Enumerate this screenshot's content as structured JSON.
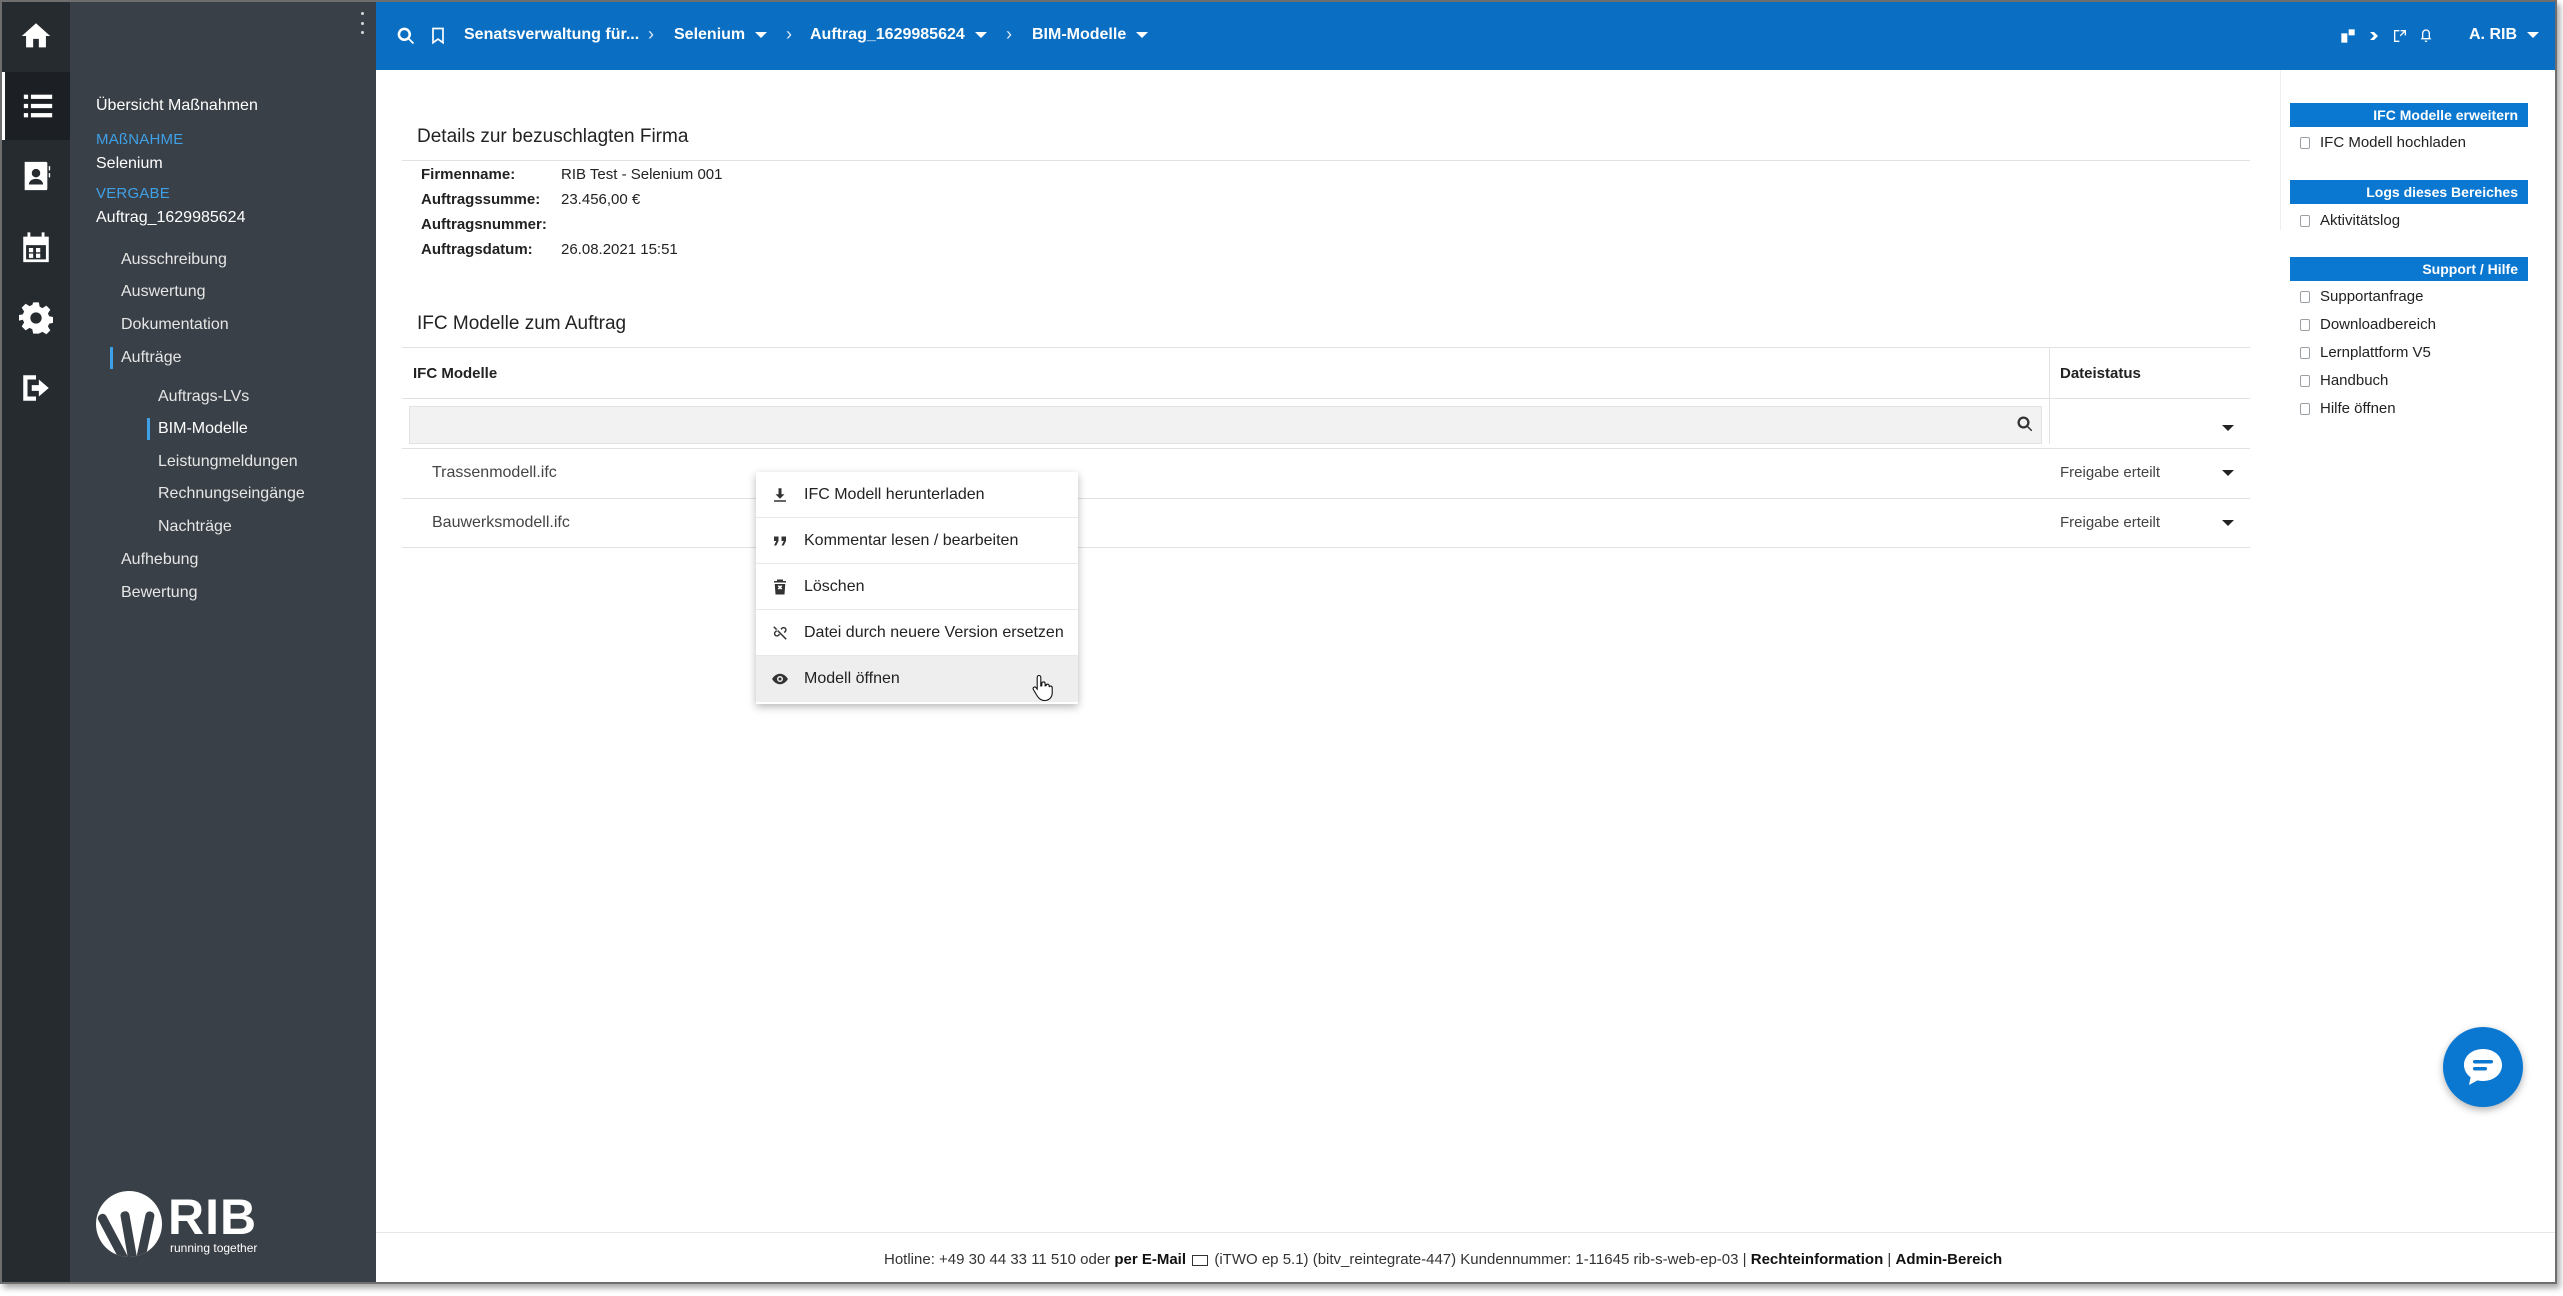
{
  "topbar": {
    "crumbs": [
      "Senatsverwaltung für...",
      "Selenium",
      "Auftrag_1629985624",
      "BIM-Modelle"
    ],
    "user": "A. RIB"
  },
  "sidebar": {
    "overview": "Übersicht Maßnahmen",
    "massnahme_caption": "MAßNAHME",
    "massnahme_value": "Selenium",
    "vergabe_caption": "VERGABE",
    "vergabe_value": "Auftrag_1629985624",
    "nav": [
      "Ausschreibung",
      "Auswertung",
      "Dokumentation",
      "Aufträge"
    ],
    "subnav": [
      "Auftrags-LVs",
      "BIM-Modelle",
      "Leistungmeldungen",
      "Rechnungseingänge",
      "Nachträge"
    ],
    "nav_bottom": [
      "Aufhebung",
      "Bewertung"
    ],
    "logo_word": "RIB",
    "logo_tagline": "running together"
  },
  "details": {
    "heading": "Details zur bezuschlagten Firma",
    "fields": [
      {
        "label": "Firmenname:",
        "value": "RIB Test - Selenium 001"
      },
      {
        "label": "Auftragssumme:",
        "value": "23.456,00 €"
      },
      {
        "label": "Auftragsnummer:",
        "value": ""
      },
      {
        "label": "Auftragsdatum:",
        "value": "26.08.2021 15:51"
      }
    ]
  },
  "models": {
    "heading": "IFC Modelle zum Auftrag",
    "col_models": "IFC Modelle",
    "col_status": "Dateistatus",
    "rows": [
      {
        "name": "Trassenmodell.ifc",
        "status": "Freigabe erteilt"
      },
      {
        "name": "Bauwerksmodell.ifc",
        "status": "Freigabe erteilt"
      }
    ]
  },
  "context_menu": {
    "items": [
      {
        "label": "IFC Modell herunterladen",
        "icon": "download-icon"
      },
      {
        "label": "Kommentar lesen / bearbeiten",
        "icon": "quote-icon"
      },
      {
        "label": "Löschen",
        "icon": "trash-icon"
      },
      {
        "label": "Datei durch neuere Version ersetzen",
        "icon": "unlink-icon"
      },
      {
        "label": "Modell öffnen",
        "icon": "eye-icon"
      }
    ]
  },
  "right_panel": {
    "sections": [
      {
        "title": "IFC Modelle erweitern",
        "links": [
          "IFC Modell hochladen"
        ]
      },
      {
        "title": "Logs dieses Bereiches",
        "links": [
          "Aktivitätslog"
        ]
      },
      {
        "title": "Support / Hilfe",
        "links": [
          "Supportanfrage",
          "Downloadbereich",
          "Lernplattform V5",
          "Handbuch",
          "Hilfe öffnen"
        ]
      }
    ]
  },
  "footer": {
    "hotline": "Hotline: +49 30 44 33 11 510 oder",
    "email": "per E-Mail",
    "version": "(iTWO ep 5.1) (bitv_reintegrate-447)   Kundennummer: 1-11645 rib-s-web-ep-03 |",
    "legal": "Rechteinformation",
    "divider": "|",
    "admin": "Admin-Bereich"
  },
  "colors": {
    "topbar": "#0a6fc2",
    "sidebar": "#3a4047",
    "rail": "#262b30",
    "accent": "#3ea1e8"
  }
}
